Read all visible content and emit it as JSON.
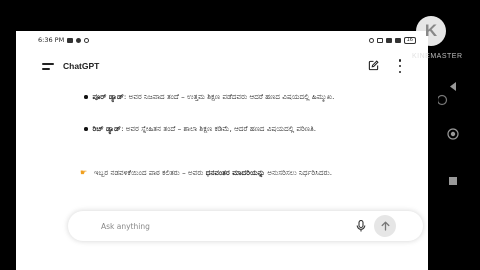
{
  "status_bar": {
    "time": "6:36 PM",
    "battery": "16"
  },
  "app": {
    "title": "ChatGPT"
  },
  "message": {
    "bullets": [
      {
        "term": "ಪೂರ್ ಡ್ಯಾಡ್",
        "text": ": ಅವರ ನಿಜವಾದ ತಂದೆ – ಉತ್ತಮ ಶಿಕ್ಷಣ ಪಡೆದವರು ಆದರೆ ಹಣದ ವಿಷಯದಲ್ಲಿ ಹಿಮ್ಮುಖ."
      },
      {
        "term": "ರಿಚ್ ಡ್ಯಾಡ್",
        "text": ": ಅವರ ಸ್ನೇಹಿತನ ತಂದೆ – ಶಾಲಾ ಶಿಕ್ಷಣ ಕಡಿಮೆ, ಆದರೆ ಹಣದ ವಿಷಯದಲ್ಲಿ ಪರಿಣತಿ."
      }
    ],
    "note_prefix": "ಇಬ್ಬರ ನಡವಳಿಕೆಯಿಂದ ಪಾಠ ಕಲಿತರು – ಅವರು ",
    "note_bold": "ಧನವಂತರ ಮಾದರಿಯನ್ನು",
    "note_suffix": " ಅನುಸರಿಸಲು ನಿರ್ಧರಿಸಿದರು."
  },
  "composer": {
    "placeholder": "Ask anything"
  },
  "watermark": {
    "text": "KINEMASTER",
    "logo": "K"
  },
  "icons": {
    "menu": "menu-icon",
    "edit": "new-chat-icon",
    "more": "more-vertical-icon",
    "mic": "microphone-icon",
    "send": "arrow-up-icon",
    "hand": "pointing-hand-icon"
  }
}
